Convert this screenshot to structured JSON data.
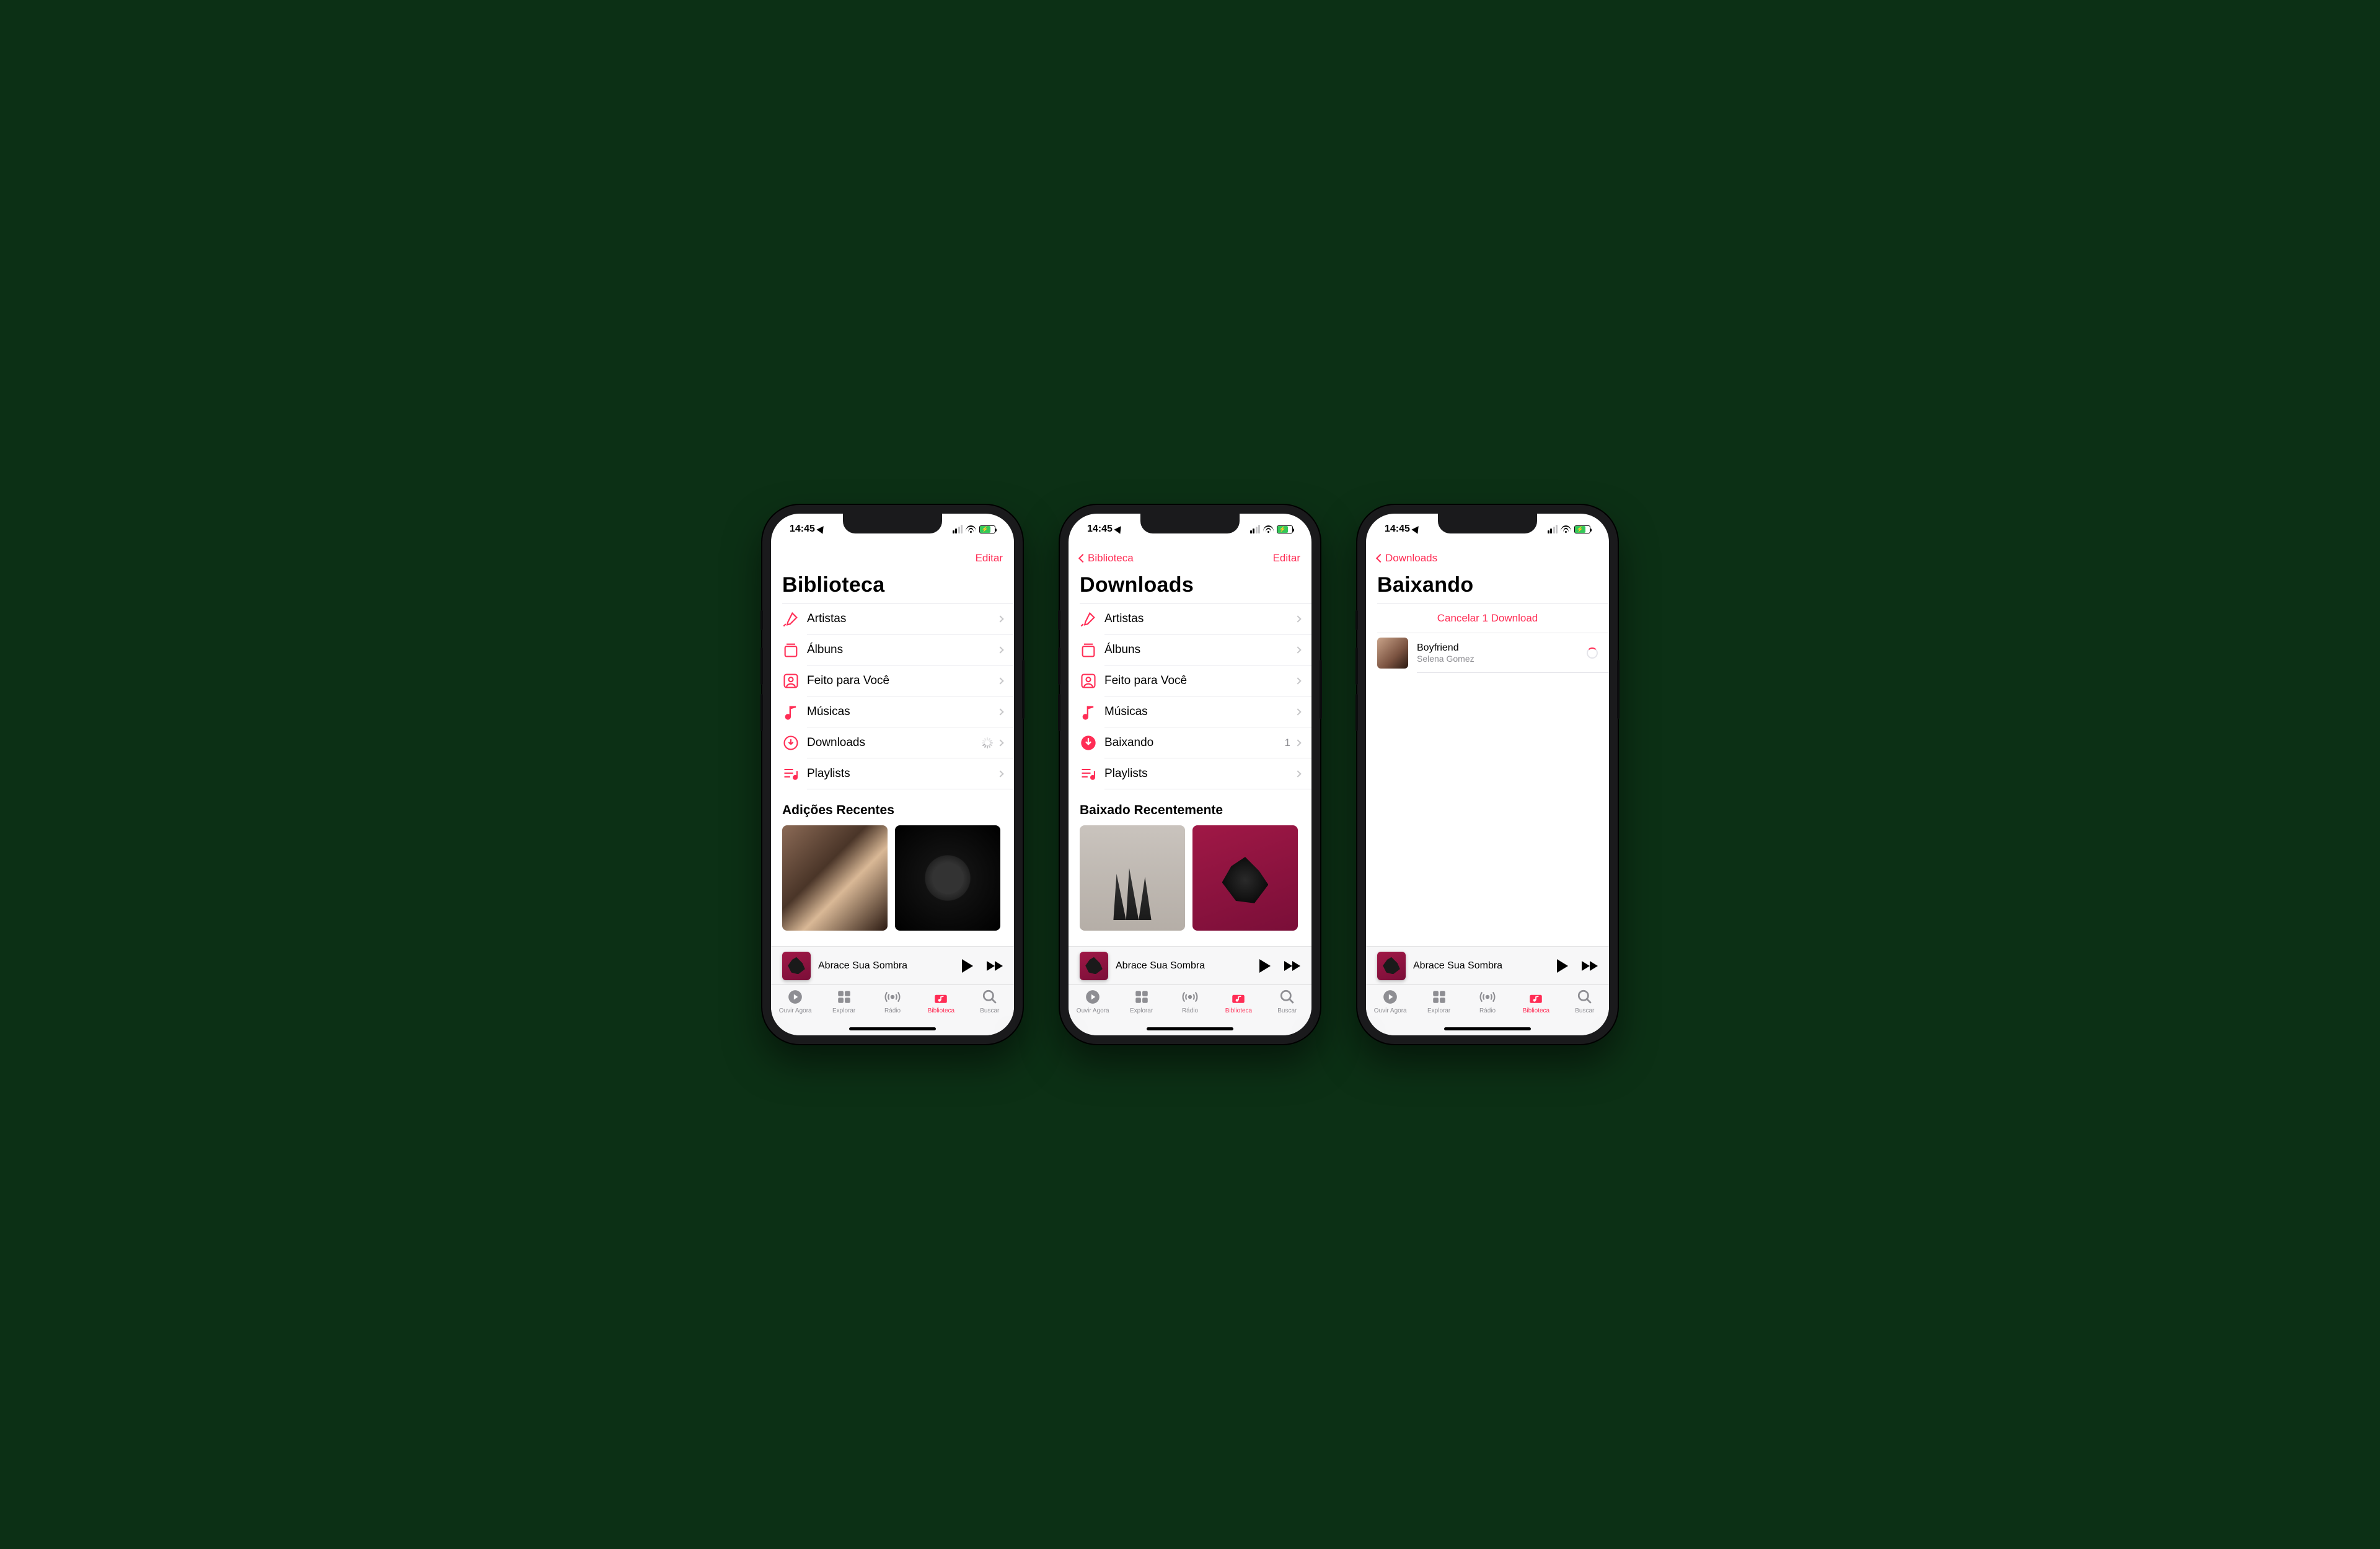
{
  "status": {
    "time": "14:45"
  },
  "tabs": {
    "listen_now": "Ouvir Agora",
    "browse": "Explorar",
    "radio": "Rádio",
    "library": "Biblioteca",
    "search": "Buscar"
  },
  "miniplayer": {
    "title": "Abrace Sua Sombra"
  },
  "screens": {
    "library": {
      "edit": "Editar",
      "title": "Biblioteca",
      "rows": {
        "artists": "Artistas",
        "albums": "Álbuns",
        "made_for_you": "Feito para Você",
        "songs": "Músicas",
        "downloads": "Downloads",
        "playlists": "Playlists"
      },
      "section": "Adições Recentes"
    },
    "downloads": {
      "back": "Biblioteca",
      "edit": "Editar",
      "title": "Downloads",
      "rows": {
        "artists": "Artistas",
        "albums": "Álbuns",
        "made_for_you": "Feito para Você",
        "songs": "Músicas",
        "downloading": "Baixando",
        "downloading_count": "1",
        "playlists": "Playlists"
      },
      "section": "Baixado Recentemente"
    },
    "downloading": {
      "back": "Downloads",
      "title": "Baixando",
      "cancel": "Cancelar 1 Download",
      "item": {
        "title": "Boyfriend",
        "artist": "Selena Gomez"
      }
    }
  }
}
